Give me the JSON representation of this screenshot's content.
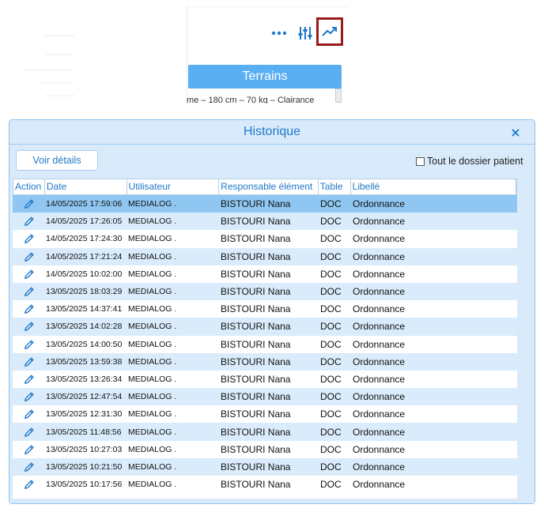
{
  "background": {
    "more_icon": "more-horizontal-icon",
    "filter_icon": "sliders-icon",
    "chart_icon": "trending-up-icon",
    "terrains_label": "Terrains",
    "patient_summary": "me – 180 cm – 70 kg – Clairance"
  },
  "dialog": {
    "title": "Historique",
    "close_glyph": "×",
    "details_button": "Voir détails",
    "checkbox_label": "Tout le dossier patient",
    "checkbox_checked": false
  },
  "table": {
    "columns": [
      "Action",
      "Date",
      "Utilisateur",
      "Responsable élément",
      "Table",
      "Libellé"
    ],
    "action_icon": "pencil-icon",
    "selected_row": 0,
    "rows": [
      {
        "date": "14/05/2025 17:59:06",
        "user": "MEDIALOG .",
        "owner": "BISTOURI Nana",
        "table": "DOC",
        "label": "Ordonnance"
      },
      {
        "date": "14/05/2025 17:26:05",
        "user": "MEDIALOG .",
        "owner": "BISTOURI Nana",
        "table": "DOC",
        "label": "Ordonnance"
      },
      {
        "date": "14/05/2025 17:24:30",
        "user": "MEDIALOG .",
        "owner": "BISTOURI Nana",
        "table": "DOC",
        "label": "Ordonnance"
      },
      {
        "date": "14/05/2025 17:21:24",
        "user": "MEDIALOG .",
        "owner": "BISTOURI Nana",
        "table": "DOC",
        "label": "Ordonnance"
      },
      {
        "date": "14/05/2025 10:02:00",
        "user": "MEDIALOG .",
        "owner": "BISTOURI Nana",
        "table": "DOC",
        "label": "Ordonnance"
      },
      {
        "date": "13/05/2025 18:03:29",
        "user": "MEDIALOG .",
        "owner": "BISTOURI Nana",
        "table": "DOC",
        "label": "Ordonnance"
      },
      {
        "date": "13/05/2025 14:37:41",
        "user": "MEDIALOG .",
        "owner": "BISTOURI Nana",
        "table": "DOC",
        "label": "Ordonnance"
      },
      {
        "date": "13/05/2025 14:02:28",
        "user": "MEDIALOG .",
        "owner": "BISTOURI Nana",
        "table": "DOC",
        "label": "Ordonnance"
      },
      {
        "date": "13/05/2025 14:00:50",
        "user": "MEDIALOG .",
        "owner": "BISTOURI Nana",
        "table": "DOC",
        "label": "Ordonnance"
      },
      {
        "date": "13/05/2025 13:59:38",
        "user": "MEDIALOG .",
        "owner": "BISTOURI Nana",
        "table": "DOC",
        "label": "Ordonnance"
      },
      {
        "date": "13/05/2025 13:26:34",
        "user": "MEDIALOG .",
        "owner": "BISTOURI Nana",
        "table": "DOC",
        "label": "Ordonnance"
      },
      {
        "date": "13/05/2025 12:47:54",
        "user": "MEDIALOG .",
        "owner": "BISTOURI Nana",
        "table": "DOC",
        "label": "Ordonnance"
      },
      {
        "date": "13/05/2025 12:31:30",
        "user": "MEDIALOG .",
        "owner": "BISTOURI Nana",
        "table": "DOC",
        "label": "Ordonnance"
      },
      {
        "date": "13/05/2025 11:48:56",
        "user": "MEDIALOG .",
        "owner": "BISTOURI Nana",
        "table": "DOC",
        "label": "Ordonnance"
      },
      {
        "date": "13/05/2025 10:27:03",
        "user": "MEDIALOG .",
        "owner": "BISTOURI Nana",
        "table": "DOC",
        "label": "Ordonnance"
      },
      {
        "date": "13/05/2025 10:21:50",
        "user": "MEDIALOG .",
        "owner": "BISTOURI Nana",
        "table": "DOC",
        "label": "Ordonnance"
      },
      {
        "date": "13/05/2025 10:17:56",
        "user": "MEDIALOG .",
        "owner": "BISTOURI Nana",
        "table": "DOC",
        "label": "Ordonnance"
      }
    ]
  },
  "colors": {
    "accent": "#1f78c8",
    "dialog_bg": "#d9ebfb",
    "row_alt": "#daecfb",
    "row_selected": "#8fc7f2",
    "terrains_bg": "#5aaef2",
    "highlight_frame": "#9a1a1a"
  }
}
